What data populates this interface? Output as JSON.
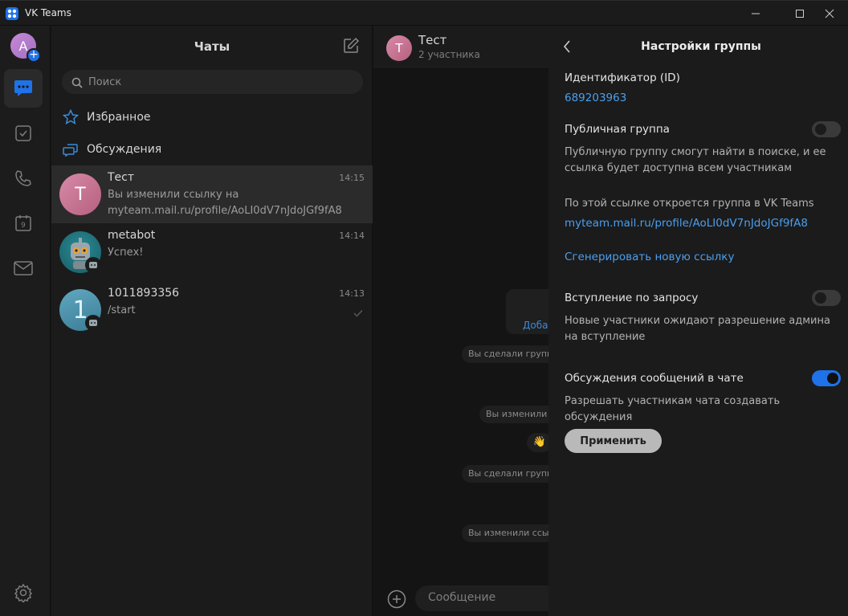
{
  "window": {
    "title": "VK Teams"
  },
  "rail": {
    "avatar_letter": "A"
  },
  "chatlist": {
    "title": "Чаты",
    "search_placeholder": "Поиск",
    "folders": [
      {
        "label": "Избранное",
        "icon": "star-icon"
      },
      {
        "label": "Обсуждения",
        "icon": "threads-icon"
      }
    ],
    "chats": [
      {
        "name": "Тест",
        "time": "14:15",
        "preview": "Вы изменили ссылку на myteam.mail.ru/profile/AoLI0dV7nJdoJGf9fA8",
        "avatar_letter": "Т"
      },
      {
        "name": "metabot",
        "time": "14:14",
        "preview": "Успех!"
      },
      {
        "name": "1011893356",
        "time": "14:13",
        "preview": "/start",
        "avatar_letter": "1"
      }
    ]
  },
  "conversation": {
    "title": "Тест",
    "subtitle": "2 участника",
    "avatar_letter": "Т",
    "card_action": "Добав",
    "system_messages": [
      "Вы сделали группу",
      "Вы изменили с",
      "Вы сделали группу",
      "Вы изменили ссыл"
    ],
    "emoji": "👋",
    "composer_placeholder": "Сообщение"
  },
  "settings": {
    "title": "Настройки группы",
    "id_label": "Идентификатор (ID)",
    "id_value": "689203963",
    "public_label": "Публичная группа",
    "public_on": false,
    "public_desc": "Публичную группу смогут найти в поиске, и ее ссылка будет доступна всем участникам",
    "link_desc": "По этой ссылке откроется группа в VK Teams",
    "link_value": "myteam.mail.ru/profile/AoLI0dV7nJdoJGf9fA8",
    "regen_link": "Сгенерировать новую ссылку",
    "join_label": "Вступление по запросу",
    "join_on": false,
    "join_desc": "Новые участники ожидают разрешение админа на вступление",
    "threads_label": "Обсуждения сообщений в чате",
    "threads_on": true,
    "threads_desc": "Разрешать участникам чата создавать обсуждения",
    "apply_label": "Применить"
  },
  "colors": {
    "accent": "#1f72e8",
    "link": "#4a9ff0"
  }
}
